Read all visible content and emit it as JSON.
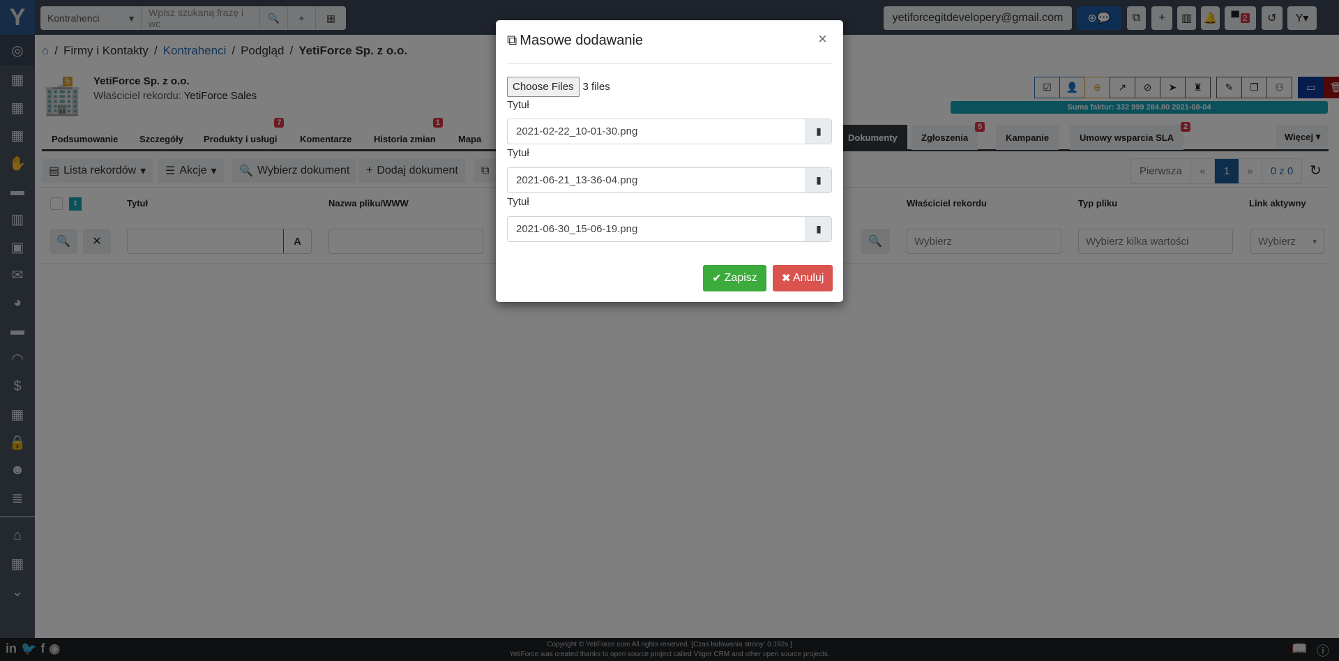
{
  "topbar": {
    "module_select": "Kontrahenci",
    "search_placeholder": "Wpisz szukaną frazę i wc",
    "user_email": "yetiforcegitdevelopery@gmail.com",
    "calendar_badge": "2"
  },
  "breadcrumb": {
    "items": [
      "Firmy i Kontakty",
      "Kontrahenci",
      "Podgląd"
    ],
    "current": "YetiForce Sp. z o.o."
  },
  "record": {
    "name": "YetiForce Sp. z o.o.",
    "owner_label": "Właściciel rekordu:",
    "owner": "YetiForce Sales",
    "badge": "5",
    "summary": "Suma faktur: 332 999 284.80 2021-08-04"
  },
  "tabs": [
    {
      "label": "Podsumowanie"
    },
    {
      "label": "Szczegóły"
    },
    {
      "label": "Produkty i usługi",
      "badge": "7"
    },
    {
      "label": "Komentarze"
    },
    {
      "label": "Historia zmian",
      "badge": "1"
    },
    {
      "label": "Mapa"
    },
    {
      "label": "Dokumenty",
      "active": true
    },
    {
      "label": "Zgłoszenia",
      "badge": "5"
    },
    {
      "label": "Kampanie"
    },
    {
      "label": "Umowy wsparcia SLA",
      "badge": "2"
    }
  ],
  "more_tab": "Więcej",
  "toolbar": {
    "list": "Lista rekordów",
    "actions": "Akcje",
    "select_doc": "Wybierz dokument",
    "add_doc": "Dodaj dokument"
  },
  "pagination": {
    "first": "Pierwsza",
    "prev": "«",
    "page": "1",
    "next": "»",
    "count": "0 z 0"
  },
  "table": {
    "headers": [
      "Tytuł",
      "Nazwa pliku/WWW",
      "Właściciel rekordu",
      "Typ pliku",
      "Link aktywny"
    ],
    "filter_owner": "Wybierz",
    "filter_type": "Wybierz kilka wartości",
    "filter_link": "Wybierz"
  },
  "modal": {
    "title": "Masowe dodawanie",
    "choose_files": "Choose Files",
    "files_count": "3 files",
    "field_label": "Tytuł",
    "files": [
      "2021-02-22_10-01-30.png",
      "2021-06-21_13-36-04.png",
      "2021-06-30_15-06-19.png"
    ],
    "save": "Zapisz",
    "cancel": "Anuluj"
  },
  "footer": {
    "line1": "Copyright © YetiForce.com All rights reserved. [Czas ładowania strony: 0.192s.]",
    "line2": "YetiForce was created thanks to open source project called Vtiger CRM and other open source projects."
  },
  "colors": {
    "save": "#3bab3b",
    "cancel": "#d9534f",
    "accent": "#17a2b8",
    "active_page": "#1f5c99"
  }
}
